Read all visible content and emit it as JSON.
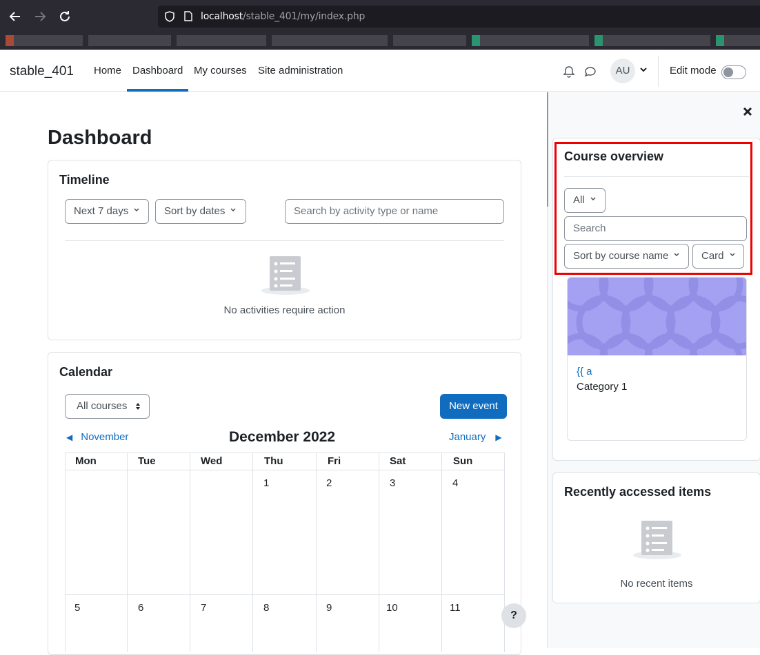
{
  "browser": {
    "url_host": "localhost",
    "url_path": "/stable_401/my/index.php"
  },
  "navbar": {
    "brand": "stable_401",
    "items": [
      "Home",
      "Dashboard",
      "My courses",
      "Site administration"
    ],
    "active_item": "Dashboard",
    "avatar_initials": "AU",
    "edit_mode_label": "Edit mode",
    "edit_mode_on": false
  },
  "main": {
    "page_title": "Dashboard",
    "timeline": {
      "title": "Timeline",
      "range_filter": "Next 7 days",
      "sort_filter": "Sort by dates",
      "search_placeholder": "Search by activity type or name",
      "empty_message": "No activities require action"
    },
    "calendar": {
      "title": "Calendar",
      "course_filter": "All courses",
      "new_event_label": "New event",
      "prev_month": "November",
      "next_month": "January",
      "current_month": "December 2022",
      "weekdays": [
        "Mon",
        "Tue",
        "Wed",
        "Thu",
        "Fri",
        "Sat",
        "Sun"
      ],
      "week1": [
        "",
        "",
        "",
        "1",
        "2",
        "3",
        "4"
      ],
      "week2": [
        "5",
        "6",
        "7",
        "8",
        "9",
        "10",
        "11"
      ]
    },
    "help_label": "?"
  },
  "drawer": {
    "course_overview": {
      "title": "Course overview",
      "grouping_filter": "All",
      "search_placeholder": "Search",
      "sort_filter": "Sort by course name",
      "view_filter": "Card",
      "course": {
        "name": "{{ a",
        "category": "Category 1"
      }
    },
    "recent_items": {
      "title": "Recently accessed items",
      "empty_message": "No recent items"
    }
  },
  "colors": {
    "primary": "#0f6cbf",
    "highlight_border": "#ee0000",
    "course_image": "#a4a1f3"
  }
}
